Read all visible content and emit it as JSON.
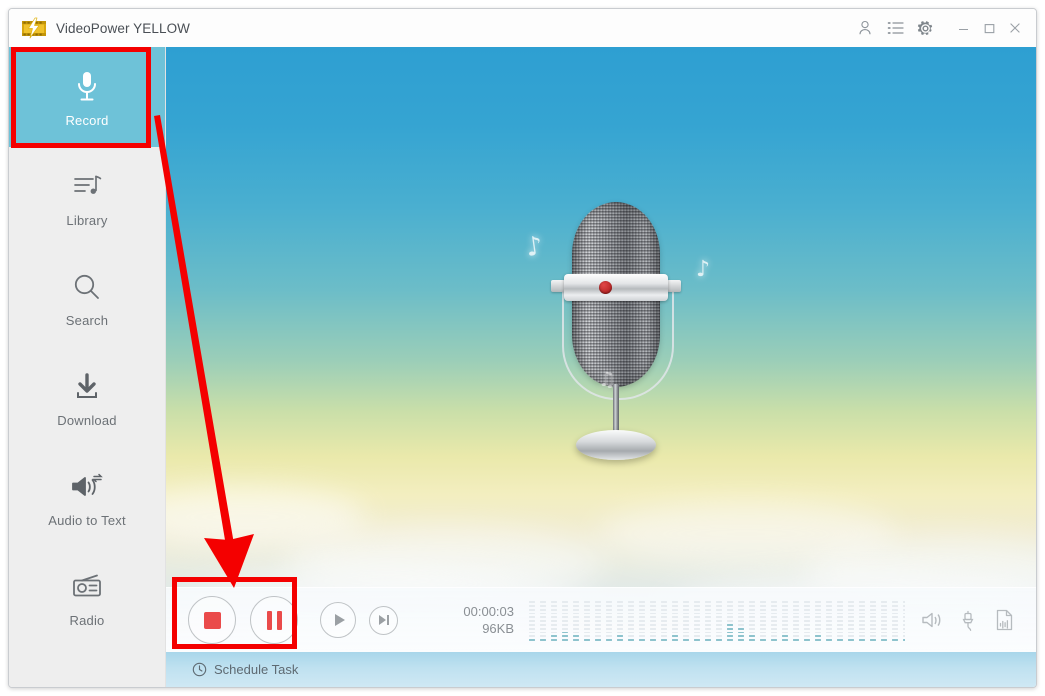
{
  "window": {
    "title": "VideoPower YELLOW",
    "logo_icon": "film-lightning-logo-icon"
  },
  "titlebar": {
    "actions": [
      {
        "name": "account-icon",
        "label": "Account"
      },
      {
        "name": "list-icon",
        "label": "Task List"
      },
      {
        "name": "gear-icon",
        "label": "Settings"
      }
    ],
    "window_buttons": [
      {
        "name": "minimize-button",
        "label": "Minimize"
      },
      {
        "name": "maximize-button",
        "label": "Maximize"
      },
      {
        "name": "close-button",
        "label": "Close"
      }
    ]
  },
  "sidebar": {
    "items": [
      {
        "label": "Record",
        "icon": "microphone-icon",
        "active": true
      },
      {
        "label": "Library",
        "icon": "music-library-icon",
        "active": false
      },
      {
        "label": "Search",
        "icon": "search-icon",
        "active": false
      },
      {
        "label": "Download",
        "icon": "download-icon",
        "active": false
      },
      {
        "label": "Audio to Text",
        "icon": "audio-to-text-icon",
        "active": false
      },
      {
        "label": "Radio",
        "icon": "radio-icon",
        "active": false
      }
    ],
    "active_color": "#6ec2d8"
  },
  "stage": {
    "artwork": "retro-microphone-illustration",
    "notes": [
      "♪",
      "♪",
      "♫"
    ]
  },
  "controls": {
    "stop_label": "Stop",
    "pause_label": "Pause",
    "play_label": "Play",
    "next_label": "Next",
    "elapsed_time": "00:00:03",
    "file_size": "96KB",
    "accent_color": "#ea4b4b",
    "meter_active_color": "#8dc3cd",
    "right_icons": [
      {
        "name": "speaker-icon",
        "label": "System Sound"
      },
      {
        "name": "microphone-in-icon",
        "label": "Microphone Input"
      },
      {
        "name": "file-waveform-icon",
        "label": "Output File"
      }
    ]
  },
  "schedule": {
    "label": "Schedule Task",
    "icon": "clock-icon"
  },
  "annotations": {
    "color": "#f40000",
    "highlight_record": "Record nav item highlighted",
    "highlight_transport": "Stop and Pause buttons highlighted",
    "arrow": "arrow from Record to transport buttons"
  }
}
